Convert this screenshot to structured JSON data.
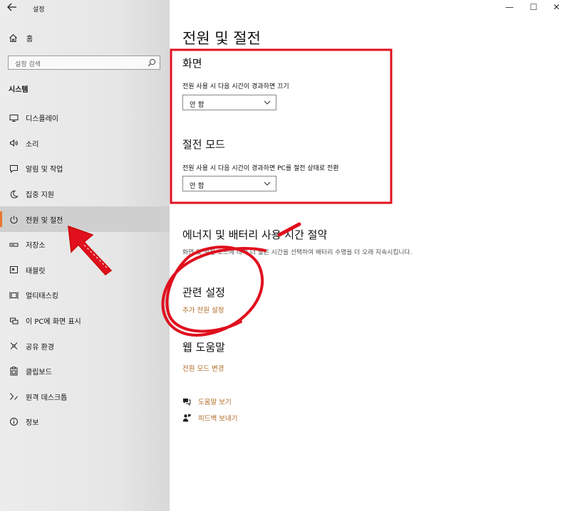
{
  "window": {
    "app_title": "설정",
    "controls": {
      "minimize": "—",
      "maximize": "☐",
      "close": "✕"
    }
  },
  "sidebar": {
    "home_label": "홈",
    "search_placeholder": "설정 검색",
    "section_label": "시스템",
    "items": [
      {
        "label": "디스플레이",
        "icon": "display-icon"
      },
      {
        "label": "소리",
        "icon": "speaker-icon"
      },
      {
        "label": "알림 및 작업",
        "icon": "notification-icon"
      },
      {
        "label": "집중 지원",
        "icon": "moon-icon"
      },
      {
        "label": "전원 및 절전",
        "icon": "power-icon",
        "active": true
      },
      {
        "label": "저장소",
        "icon": "storage-icon"
      },
      {
        "label": "태블릿",
        "icon": "tablet-icon"
      },
      {
        "label": "멀티태스킹",
        "icon": "multitasking-icon"
      },
      {
        "label": "이 PC에 화면 표시",
        "icon": "project-icon"
      },
      {
        "label": "공유 환경",
        "icon": "share-icon"
      },
      {
        "label": "클립보드",
        "icon": "clipboard-icon"
      },
      {
        "label": "원격 데스크톱",
        "icon": "remote-desktop-icon"
      },
      {
        "label": "정보",
        "icon": "info-icon"
      }
    ]
  },
  "main": {
    "title": "전원 및 절전",
    "screen": {
      "heading": "화면",
      "description": "전원 사용 시 다음 시간이 경과하면 끄기",
      "value": "안 함"
    },
    "sleep": {
      "heading": "절전 모드",
      "description": "전원 사용 시 다음 시간이 경과하면 PC를 절전 상태로 전환",
      "value": "안 함"
    },
    "energy": {
      "heading": "에너지 및 배터리 사용 시간 절약",
      "description": "화면 및 절전 모드에 대해 더 짧은 시간을 선택하여 배터리 수명을 더 오래 지속시킵니다."
    },
    "related": {
      "heading": "관련 설정",
      "link": "추가 전원 설정"
    },
    "web_help": {
      "heading": "웹 도움말",
      "link": "전원 모드 변경"
    },
    "help_links": {
      "get_help": "도움말 보기",
      "feedback": "피드백 보내기"
    }
  },
  "annotation_color": "#e0101e"
}
